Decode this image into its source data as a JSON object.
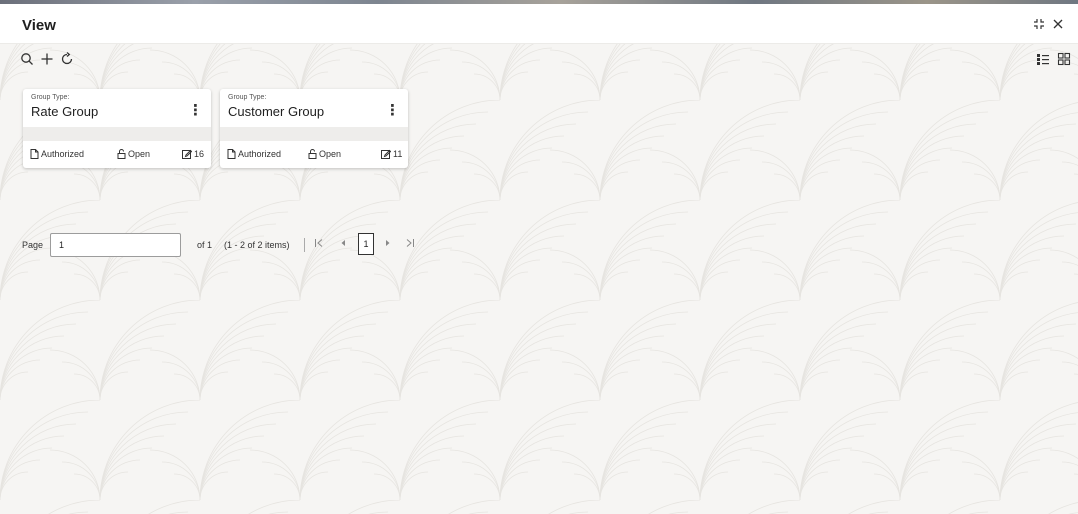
{
  "window": {
    "title": "View",
    "icons": {
      "maximize": "expand-icon",
      "close": "close-icon"
    }
  },
  "toolbar": {
    "icons": [
      "search-icon",
      "add-icon",
      "refresh-icon",
      "list-view-icon",
      "grid-view-icon"
    ]
  },
  "cards": [
    {
      "label": "Group Type:",
      "name": "Rate Group",
      "status": "Authorized",
      "lock_state": "Open",
      "edit_count": "16"
    },
    {
      "label": "Group Type:",
      "name": "Customer Group",
      "status": "Authorized",
      "lock_state": "Open",
      "edit_count": "11"
    }
  ],
  "pagination": {
    "page_label": "Page",
    "page_value": "1",
    "of_label": "of 1",
    "items_label": "(1 - 2 of 2 items)",
    "current_page": "1"
  },
  "colors": {
    "background": "#f5f4f2",
    "card": "#ffffff",
    "card_band": "#eeedeb"
  }
}
